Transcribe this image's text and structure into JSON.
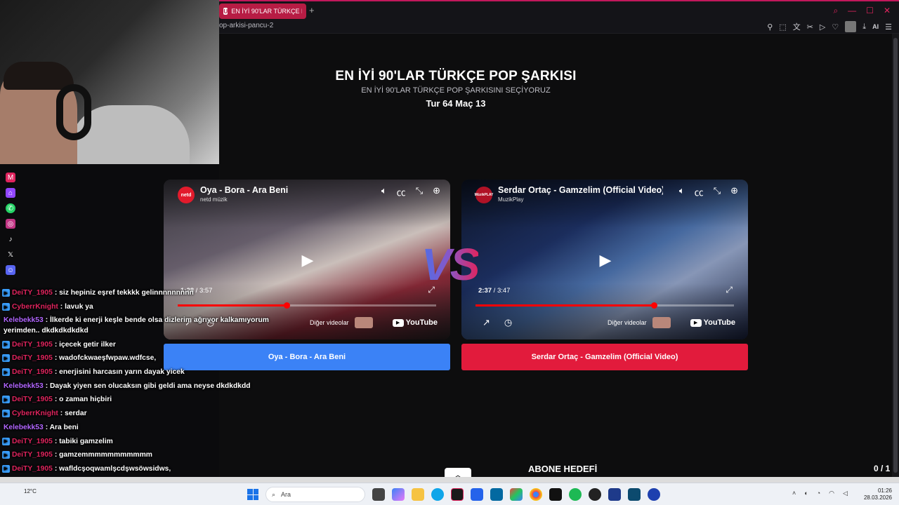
{
  "browser": {
    "tab_title": "EN İYİ 90'LAR TÜRKÇE POP ŞARKISI",
    "tab_favicon": "U",
    "new_tab": "+",
    "url_fragment": "op-arkisi-pancu-2",
    "ai_label": "AI"
  },
  "page": {
    "title": "EN İYİ 90'LAR TÜRKÇE POP ŞARKISI",
    "subtitle": "EN İYİ 90'LAR TÜRKÇE POP ŞARKISINI SEÇİYORUZ",
    "round": "Tur 64 Maç 13",
    "vs": "VS",
    "abone_label": "ABONE HEDEFİ",
    "abone_count": "0 / 1"
  },
  "videos": [
    {
      "title": "Oya - Bora - Ara Beni",
      "channel": "netd müzik",
      "channel_logo": "netd",
      "time_current": "1:28",
      "time_total": "3:57",
      "progress": 0.42,
      "more_videos": "Diğer videolar",
      "youtube": "YouTube",
      "vote_label": "Oya - Bora - Ara Beni"
    },
    {
      "title": "Serdar Ortaç - Gamzelim (Official Video)",
      "channel": "MuzikPlay",
      "channel_logo": "MüzikPLAY",
      "time_current": "2:37",
      "time_total": "3:47",
      "progress": 0.69,
      "more_videos": "Diğer videolar",
      "youtube": "YouTube",
      "vote_label": "Serdar Ortaç - Gamzelim (Official Video)"
    }
  ],
  "chat": [
    {
      "user": "DeiTY_1905",
      "text": ": siz hepiniz eşref tekkkk gelinnnnnnnnn",
      "color": "#e0245e",
      "badge": true
    },
    {
      "user": "CyberrKnight",
      "text": ": lavuk ya",
      "color": "#e0245e",
      "badge": true
    },
    {
      "user": "Kelebekk53",
      "text": ": İlkerde ki enerji keşle bende olsa dizlerim ağrıyor kalkamıyorum yerimden.. dkdkdkdkdkd",
      "color": "#b266ff",
      "badge": false
    },
    {
      "user": "DeiTY_1905",
      "text": ": içecek getir ilker",
      "color": "#e0245e",
      "badge": true
    },
    {
      "user": "DeiTY_1905",
      "text": ": wadofckwaeşfwpaw.wdfcse,",
      "color": "#e0245e",
      "badge": true
    },
    {
      "user": "DeiTY_1905",
      "text": ": enerjisini harcasın yarın dayak yicek",
      "color": "#e0245e",
      "badge": true
    },
    {
      "user": "Kelebekk53",
      "text": ": Dayak yiyen sen olucaksın gibi geldi ama neyse dkdkdkdd",
      "color": "#b266ff",
      "badge": false
    },
    {
      "user": "DeiTY_1905",
      "text": ": o zaman hiçbiri",
      "color": "#e0245e",
      "badge": true
    },
    {
      "user": "CyberrKnight",
      "text": ": serdar",
      "color": "#e0245e",
      "badge": true
    },
    {
      "user": "Kelebekk53",
      "text": ": Ara beni",
      "color": "#b266ff",
      "badge": false
    },
    {
      "user": "DeiTY_1905",
      "text": ": tabiki gamzelim",
      "color": "#e0245e",
      "badge": true
    },
    {
      "user": "DeiTY_1905",
      "text": ": gamzemmmmmmmmmmm",
      "color": "#e0245e",
      "badge": true
    },
    {
      "user": "DeiTY_1905",
      "text": ": wafldcşoqwamlşcdşwsöwsidws,",
      "color": "#e0245e",
      "badge": true
    }
  ],
  "taskbar": {
    "temp": "12°C",
    "search_placeholder": "Ara",
    "time": "01:26",
    "date": "28.03.2026"
  },
  "colors": {
    "accent": "#e0245e",
    "vote_left": "#3b82f6",
    "vote_right": "#e21b3c"
  }
}
